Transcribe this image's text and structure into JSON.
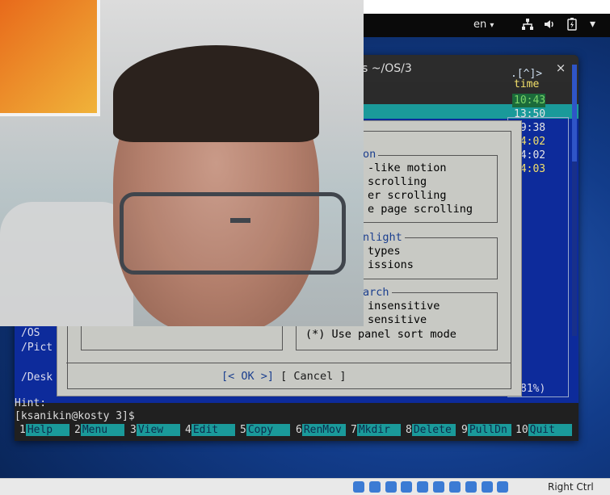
{
  "topbar": {
    "language": "en",
    "icons": [
      "network-icon",
      "volume-icon",
      "battery-icon",
      "menu-caret-icon"
    ]
  },
  "terminal": {
    "title_visible": "s ~/OS/3",
    "close_symbol": "×"
  },
  "mc": {
    "panel_right_top": ".[^]>",
    "panel_col_title": "time",
    "times": [
      {
        "value": "10:43",
        "color": "#7bd46a"
      },
      {
        "value": "13:50",
        "color": "#e6e6e6"
      },
      {
        "value": "09:38",
        "color": "#e6e6e6"
      },
      {
        "value": "14:02",
        "color": "#f3e06a"
      },
      {
        "value": "14:02",
        "color": "#e6e6e6"
      },
      {
        "value": "14:03",
        "color": "#f3e06a"
      }
    ],
    "left_items": [
      "/OS",
      "/Pict",
      "/Desk"
    ],
    "percent": "81%)"
  },
  "dialog": {
    "group1_title": "on",
    "group1_lines": [
      "-like motion",
      "scrolling",
      "er scrolling",
      "e page scrolling"
    ],
    "group2_title": "nlight",
    "group2_lines": [
      "types",
      "issions"
    ],
    "group3_title": "arch",
    "group3_lines": [
      "insensitive",
      "sensitive",
      "(*) Use panel sort mode"
    ],
    "buttons": {
      "ok": "[< OK >]",
      "cancel": "[ Cancel ]"
    }
  },
  "hint_label": "Hint:",
  "prompt": "[ksanikin@kosty 3]$",
  "function_keys": [
    {
      "num": "1",
      "label": "Help"
    },
    {
      "num": "2",
      "label": "Menu"
    },
    {
      "num": "3",
      "label": "View"
    },
    {
      "num": "4",
      "label": "Edit"
    },
    {
      "num": "5",
      "label": "Copy"
    },
    {
      "num": "6",
      "label": "RenMov"
    },
    {
      "num": "7",
      "label": "Mkdir"
    },
    {
      "num": "8",
      "label": "Delete"
    },
    {
      "num": "9",
      "label": "PullDn"
    },
    {
      "num": "10",
      "label": "Quit"
    }
  ],
  "statusbar": {
    "host_key": "Right Ctrl"
  }
}
